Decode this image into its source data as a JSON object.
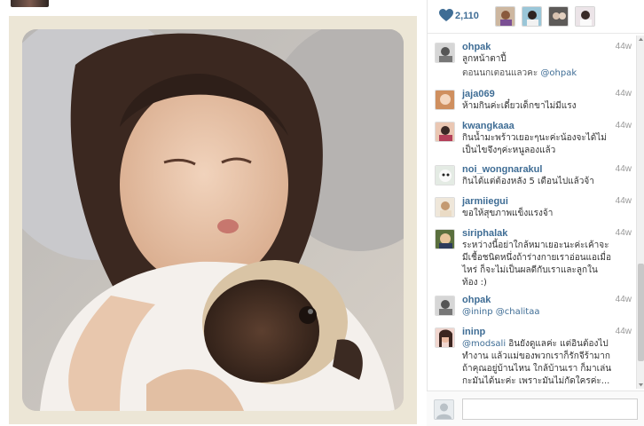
{
  "likes": {
    "count": "2,110"
  },
  "comments_cut": {
    "text": "ตอนนกเตอนแลวคะ ",
    "mention": "@ohpak"
  },
  "comments": [
    {
      "user": "ohpak",
      "time": "44w",
      "text": "ลูกหน้าตาปี้",
      "mention": ""
    },
    {
      "user": "jaja069",
      "time": "44w",
      "text": "ห้ามกินค่ะเดี๋ยวเด็กขาไม่มีแรง",
      "mention": ""
    },
    {
      "user": "kwangkaaa",
      "time": "44w",
      "text": "กินน้ำมะพร้าวเยอะๆนะค่ะน้องจะได้ไม่เป็นไขจึงๆค่ะหนูลองแล้ว",
      "mention": ""
    },
    {
      "user": "noi_wongnarakul",
      "time": "44w",
      "text": "กินได้แต่ต้องหลัง 5 เดือนไปแล้วจ้า",
      "mention": ""
    },
    {
      "user": "jarmiiegui",
      "time": "44w",
      "text": "ขอให้สุขภาพแข็งแรงจ้า",
      "mention": ""
    },
    {
      "user": "siriphalak",
      "time": "44w",
      "text": "ระหว่างนี้อย่าใกล้หมาเยอะนะค่ะเค้าจะมีเชื้อชนิดหนึ่งถ้าร่างกายเราอ่อนแอเมื่อไหร่ ก็จะไม่เป็นผลดีกับเราและลูกในท้อง :)",
      "mention": ""
    },
    {
      "user": "ohpak",
      "time": "44w",
      "text": "",
      "mention": "@ininp @chalitaa"
    },
    {
      "user": "ininp",
      "time": "44w",
      "text": " อินยังดูแลค่ะ แต่อินต้องไปทำงาน แล้วแม่ของพวกเราก็รักจีร้ามาก ถ้าคุณอยู่บ้านไหน ใกล้บ้านเรา ก็มาเล่นกะมันได้นะค่ะ เพราะมันไม่กัดใครค่ะ...",
      "mention": "@modsali"
    }
  ],
  "comment_input": {
    "value": ""
  }
}
